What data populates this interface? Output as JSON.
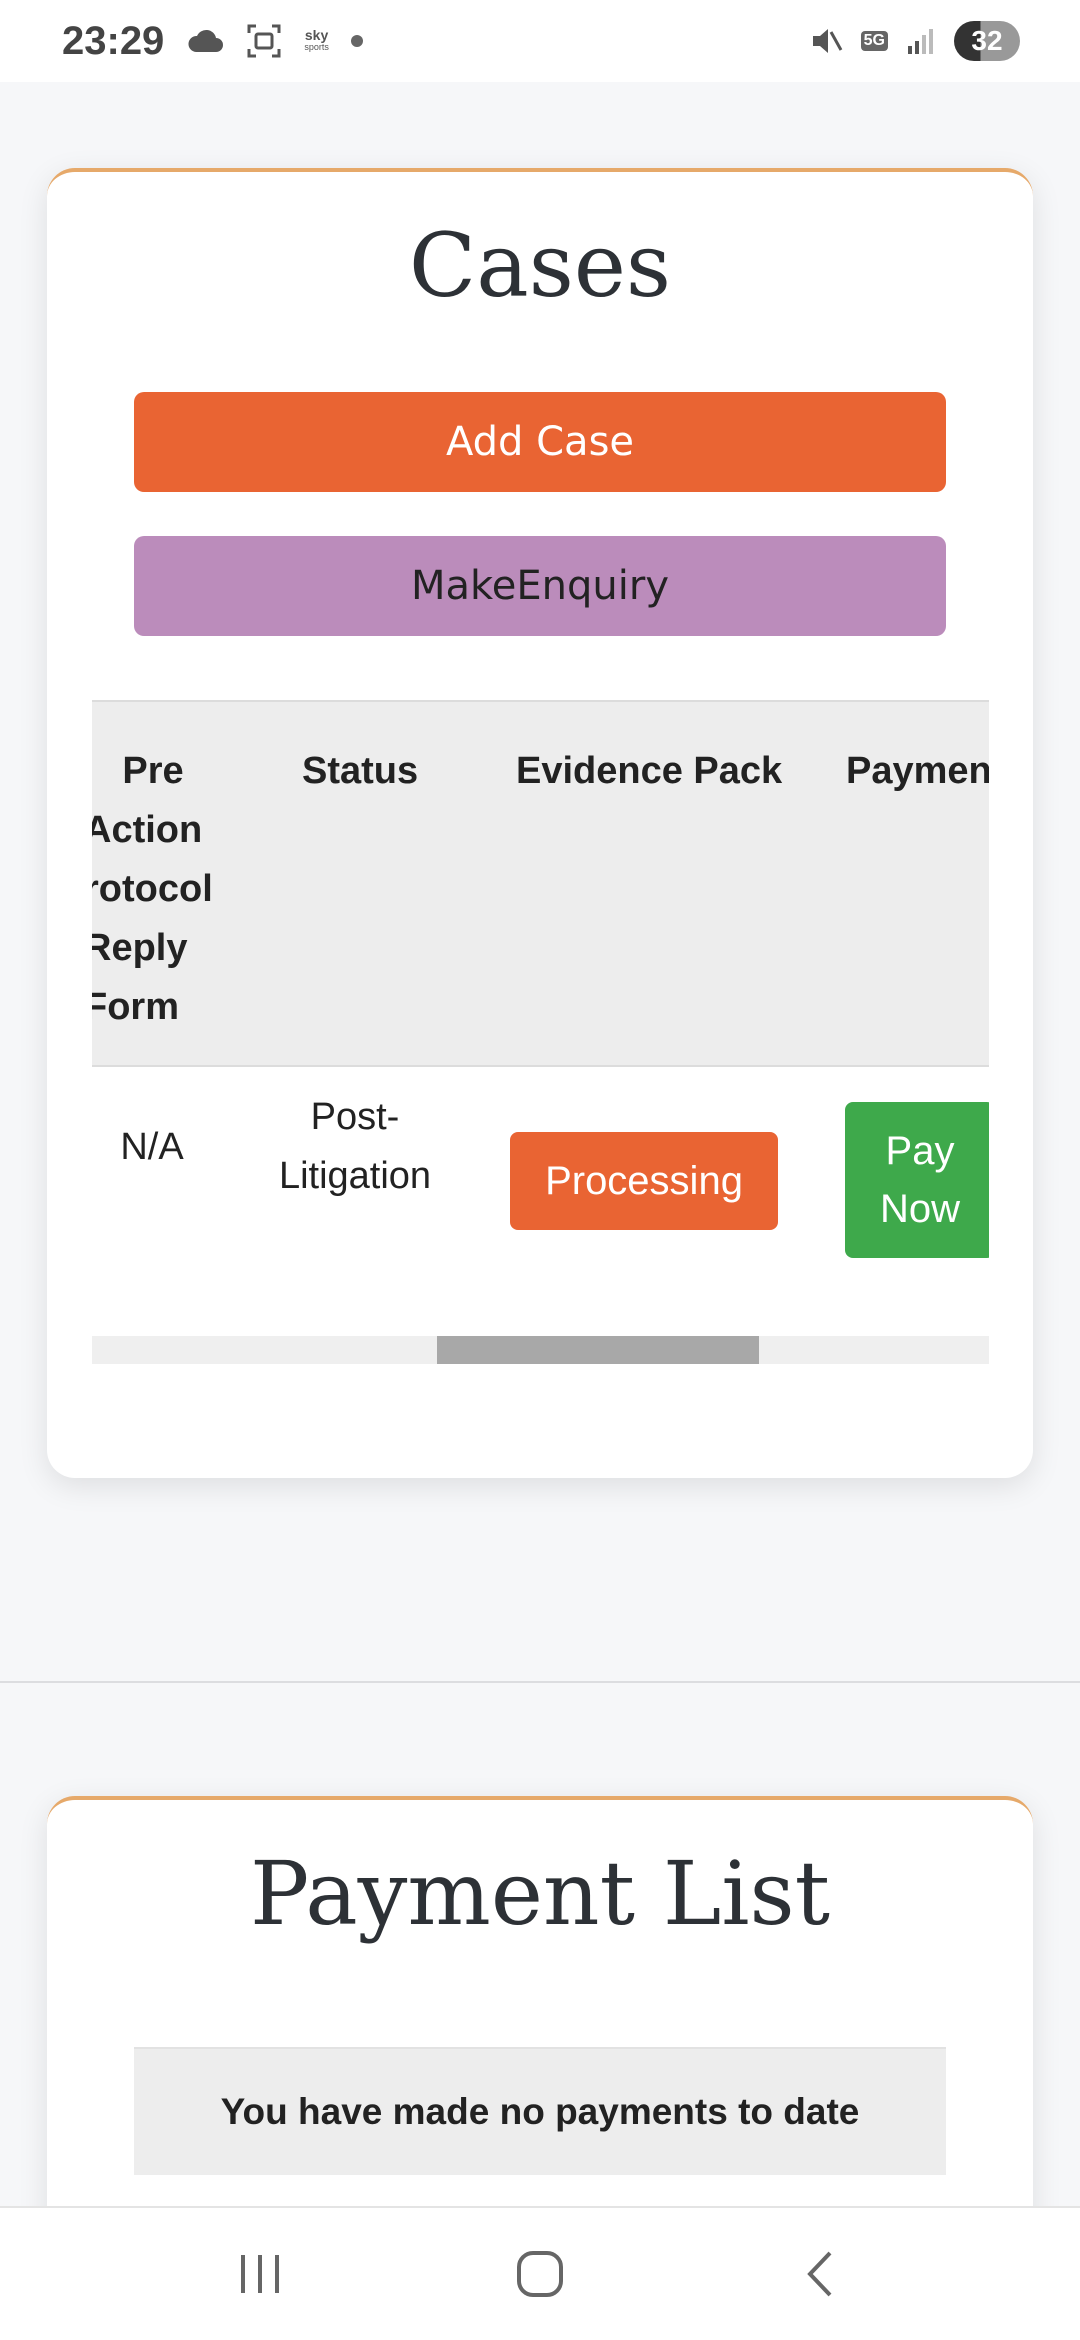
{
  "status_bar": {
    "time": "23:29",
    "sky_label": "sky",
    "sky_sub": "sports",
    "network_badge": "5G",
    "battery": "32"
  },
  "cases": {
    "title": "Cases",
    "add_case_label": "Add Case",
    "make_enquiry_label": "MakeEnquiry",
    "table": {
      "headers": [
        "Pre Action Protocol Reply Form",
        "Status",
        "Evidence Pack",
        "Paymen"
      ],
      "header_lines_col0": [
        "Pre",
        "Action",
        "rotocol",
        "Reply",
        "Form"
      ],
      "row": {
        "protocol_form": "N/A",
        "status_line1": "Post-",
        "status_line2": "Litigation",
        "evidence_pack": "Processing",
        "pay_line1": "Pay",
        "pay_line2": "Now"
      }
    },
    "horizontal_scroll_position": 0.6
  },
  "payments": {
    "title": "Payment List",
    "empty_message": "You have made no payments to date"
  },
  "colors": {
    "accent_orange": "#e96433",
    "enquiry_purple": "#bb8cbb",
    "pay_green": "#3ea94b",
    "card_top_border": "#e6a96a"
  },
  "icons": [
    "cloud-icon",
    "screenshot-icon",
    "mute-icon",
    "signal-icon",
    "recents-icon",
    "home-icon",
    "back-icon"
  ]
}
